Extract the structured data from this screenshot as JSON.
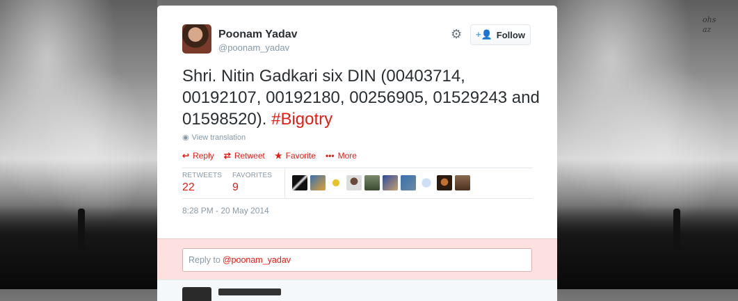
{
  "background": {
    "text_line1": "ohs",
    "text_line2": "az"
  },
  "tweet": {
    "author_name": "Poonam Yadav",
    "author_handle": "@poonam_yadav",
    "follow_label": "Follow",
    "text_main": "Shri. Nitin Gadkari  six  DIN (00403714, 00192107, 00192180, 00256905, 01529243 and 01598520). ",
    "hashtag": "#Bigotry",
    "view_translation": "View translation",
    "actions": {
      "reply": "Reply",
      "retweet": "Retweet",
      "favorite": "Favorite",
      "more": "More"
    },
    "stats": {
      "retweets_label": "RETWEETS",
      "retweets_value": "22",
      "favorites_label": "FAVORITES",
      "favorites_value": "9"
    },
    "timestamp": "8:28 PM - 20 May 2014"
  },
  "reply": {
    "prefix": "Reply to",
    "mention": "@poonam_yadav"
  },
  "colors": {
    "accent": "#e61b14",
    "text": "#292f33",
    "muted": "#8899a6",
    "reply_bg": "#fde1e1"
  },
  "icons": {
    "settings": "gear-icon",
    "follow": "add-user-icon",
    "translate": "globe-icon",
    "reply": "reply-icon",
    "retweet": "retweet-icon",
    "favorite": "star-icon",
    "more": "more-dots-icon"
  }
}
